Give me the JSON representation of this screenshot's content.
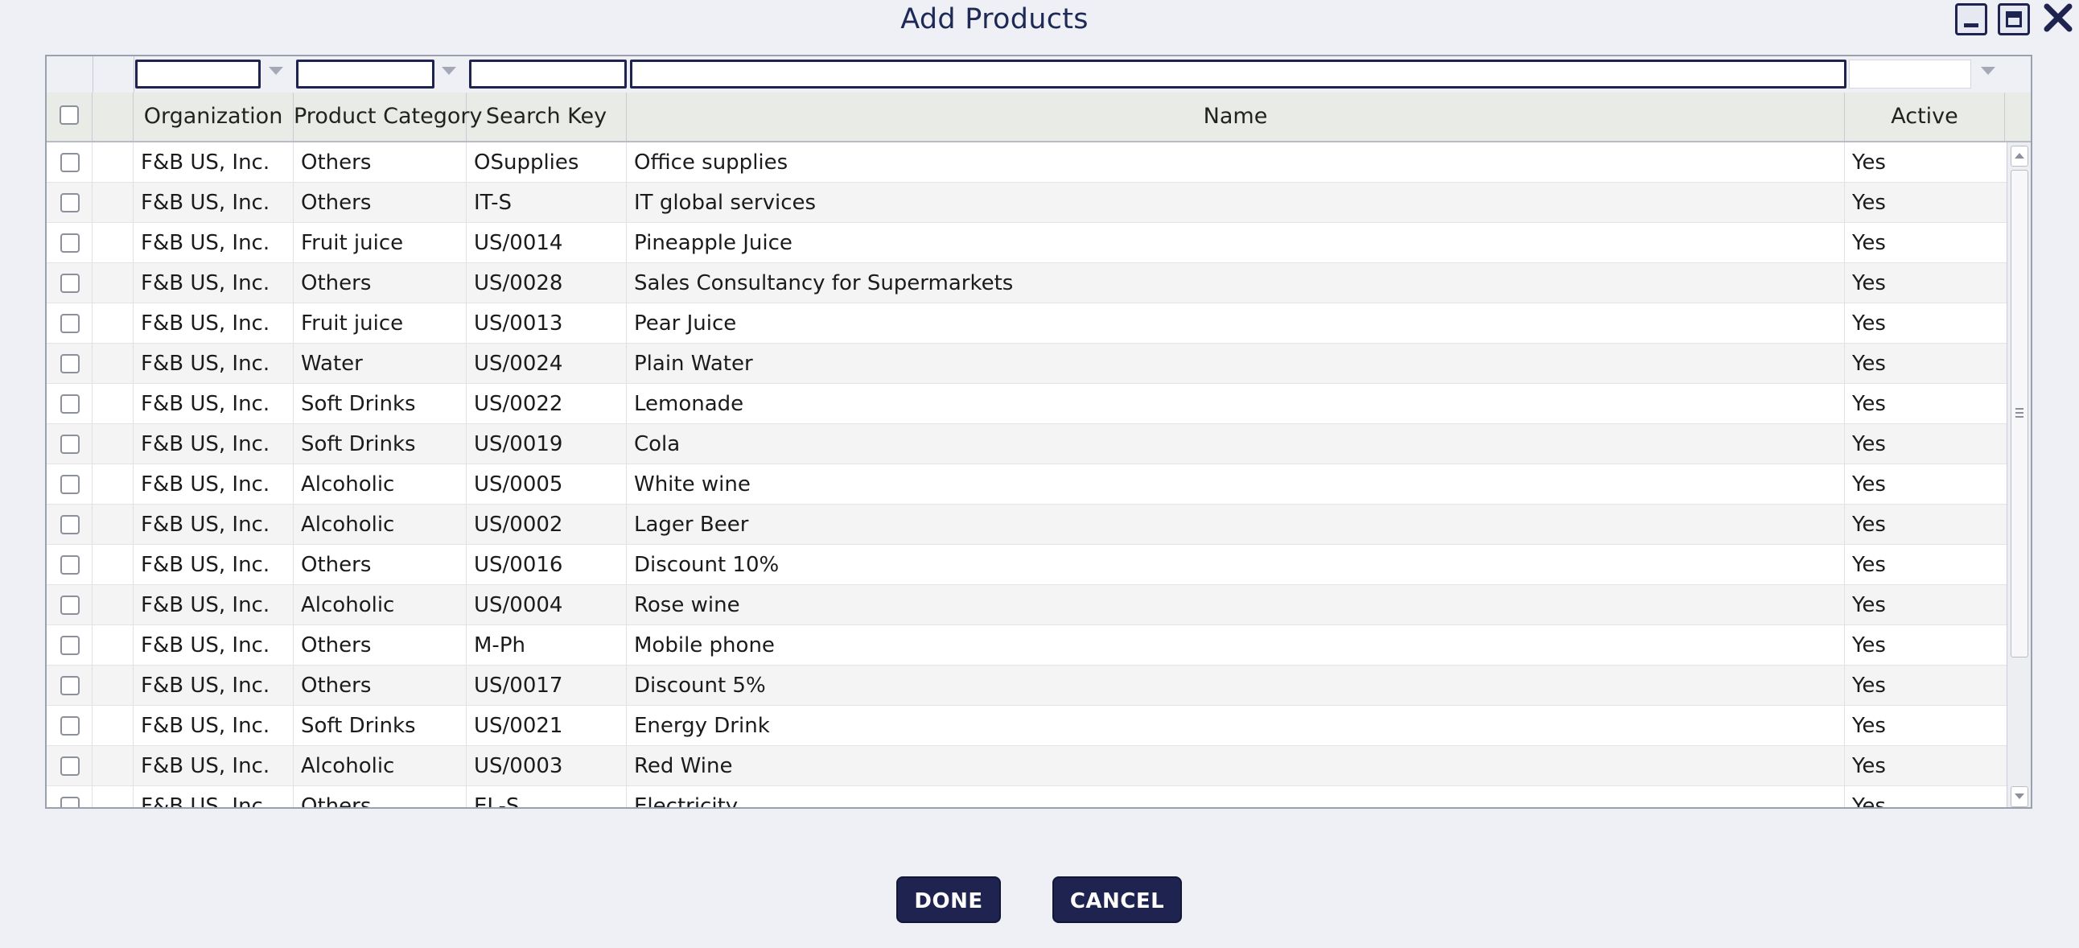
{
  "dialog": {
    "title": "Add Products"
  },
  "window_controls": {
    "minimize": "minimize-icon",
    "maximize": "maximize-icon",
    "close": "close-icon"
  },
  "columns": {
    "organization": "Organization",
    "product_category": "Product Category",
    "search_key": "Search Key",
    "name": "Name",
    "active": "Active"
  },
  "filters": {
    "organization": "",
    "product_category": "",
    "search_key": "",
    "name": "",
    "active": ""
  },
  "rows": [
    {
      "org": "F&B US, Inc.",
      "category": "Others",
      "key": "OSupplies",
      "name": "Office supplies",
      "active": "Yes"
    },
    {
      "org": "F&B US, Inc.",
      "category": "Others",
      "key": "IT-S",
      "name": "IT global services",
      "active": "Yes"
    },
    {
      "org": "F&B US, Inc.",
      "category": "Fruit juice",
      "key": "US/0014",
      "name": "Pineapple Juice",
      "active": "Yes"
    },
    {
      "org": "F&B US, Inc.",
      "category": "Others",
      "key": "US/0028",
      "name": "Sales Consultancy for Supermarkets",
      "active": "Yes"
    },
    {
      "org": "F&B US, Inc.",
      "category": "Fruit juice",
      "key": "US/0013",
      "name": "Pear Juice",
      "active": "Yes"
    },
    {
      "org": "F&B US, Inc.",
      "category": "Water",
      "key": "US/0024",
      "name": "Plain Water",
      "active": "Yes"
    },
    {
      "org": "F&B US, Inc.",
      "category": "Soft Drinks",
      "key": "US/0022",
      "name": "Lemonade",
      "active": "Yes"
    },
    {
      "org": "F&B US, Inc.",
      "category": "Soft Drinks",
      "key": "US/0019",
      "name": "Cola",
      "active": "Yes"
    },
    {
      "org": "F&B US, Inc.",
      "category": "Alcoholic",
      "key": "US/0005",
      "name": "White wine",
      "active": "Yes"
    },
    {
      "org": "F&B US, Inc.",
      "category": "Alcoholic",
      "key": "US/0002",
      "name": "Lager Beer",
      "active": "Yes"
    },
    {
      "org": "F&B US, Inc.",
      "category": "Others",
      "key": "US/0016",
      "name": "Discount 10%",
      "active": "Yes"
    },
    {
      "org": "F&B US, Inc.",
      "category": "Alcoholic",
      "key": "US/0004",
      "name": "Rose wine",
      "active": "Yes"
    },
    {
      "org": "F&B US, Inc.",
      "category": "Others",
      "key": "M-Ph",
      "name": "Mobile phone",
      "active": "Yes"
    },
    {
      "org": "F&B US, Inc.",
      "category": "Others",
      "key": "US/0017",
      "name": "Discount 5%",
      "active": "Yes"
    },
    {
      "org": "F&B US, Inc.",
      "category": "Soft Drinks",
      "key": "US/0021",
      "name": "Energy Drink",
      "active": "Yes"
    },
    {
      "org": "F&B US, Inc.",
      "category": "Alcoholic",
      "key": "US/0003",
      "name": "Red Wine",
      "active": "Yes"
    },
    {
      "org": "F&B US, Inc.",
      "category": "Others",
      "key": "EL-S",
      "name": "Electricity",
      "active": "Yes"
    }
  ],
  "buttons": {
    "done": "DONE",
    "cancel": "CANCEL"
  },
  "colors": {
    "primary": "#1e2350",
    "header_bg": "#e9ece6",
    "background": "#eef0f5"
  }
}
